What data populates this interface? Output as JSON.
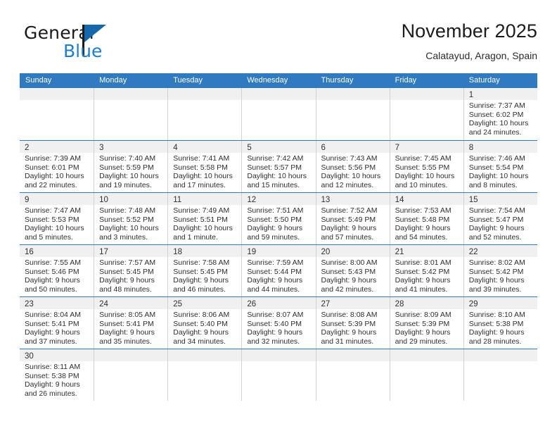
{
  "brand": {
    "name_part1": "General",
    "name_part2": "Blue",
    "flag_icon": "blue-triangle-flag",
    "colors": {
      "dark": "#1a1a1a",
      "blue": "#1a7fd4",
      "flag": "#1667ad"
    }
  },
  "header": {
    "title": "November 2025",
    "subtitle": "Calatayud, Aragon, Spain"
  },
  "theme": {
    "header_bar": "#2f7ac0",
    "row_divider": "#2f7ac0",
    "cell_divider": "#d2d2d2",
    "daynum_band": "#f0f0f0"
  },
  "calendar": {
    "weekday_headers": [
      "Sunday",
      "Monday",
      "Tuesday",
      "Wednesday",
      "Thursday",
      "Friday",
      "Saturday"
    ],
    "weeks": [
      [
        {
          "day": "",
          "lines": []
        },
        {
          "day": "",
          "lines": []
        },
        {
          "day": "",
          "lines": []
        },
        {
          "day": "",
          "lines": []
        },
        {
          "day": "",
          "lines": []
        },
        {
          "day": "",
          "lines": []
        },
        {
          "day": "1",
          "lines": [
            "Sunrise: 7:37 AM",
            "Sunset: 6:02 PM",
            "Daylight: 10 hours",
            "and 24 minutes."
          ]
        }
      ],
      [
        {
          "day": "2",
          "lines": [
            "Sunrise: 7:39 AM",
            "Sunset: 6:01 PM",
            "Daylight: 10 hours",
            "and 22 minutes."
          ]
        },
        {
          "day": "3",
          "lines": [
            "Sunrise: 7:40 AM",
            "Sunset: 5:59 PM",
            "Daylight: 10 hours",
            "and 19 minutes."
          ]
        },
        {
          "day": "4",
          "lines": [
            "Sunrise: 7:41 AM",
            "Sunset: 5:58 PM",
            "Daylight: 10 hours",
            "and 17 minutes."
          ]
        },
        {
          "day": "5",
          "lines": [
            "Sunrise: 7:42 AM",
            "Sunset: 5:57 PM",
            "Daylight: 10 hours",
            "and 15 minutes."
          ]
        },
        {
          "day": "6",
          "lines": [
            "Sunrise: 7:43 AM",
            "Sunset: 5:56 PM",
            "Daylight: 10 hours",
            "and 12 minutes."
          ]
        },
        {
          "day": "7",
          "lines": [
            "Sunrise: 7:45 AM",
            "Sunset: 5:55 PM",
            "Daylight: 10 hours",
            "and 10 minutes."
          ]
        },
        {
          "day": "8",
          "lines": [
            "Sunrise: 7:46 AM",
            "Sunset: 5:54 PM",
            "Daylight: 10 hours",
            "and 8 minutes."
          ]
        }
      ],
      [
        {
          "day": "9",
          "lines": [
            "Sunrise: 7:47 AM",
            "Sunset: 5:53 PM",
            "Daylight: 10 hours",
            "and 5 minutes."
          ]
        },
        {
          "day": "10",
          "lines": [
            "Sunrise: 7:48 AM",
            "Sunset: 5:52 PM",
            "Daylight: 10 hours",
            "and 3 minutes."
          ]
        },
        {
          "day": "11",
          "lines": [
            "Sunrise: 7:49 AM",
            "Sunset: 5:51 PM",
            "Daylight: 10 hours",
            "and 1 minute."
          ]
        },
        {
          "day": "12",
          "lines": [
            "Sunrise: 7:51 AM",
            "Sunset: 5:50 PM",
            "Daylight: 9 hours",
            "and 59 minutes."
          ]
        },
        {
          "day": "13",
          "lines": [
            "Sunrise: 7:52 AM",
            "Sunset: 5:49 PM",
            "Daylight: 9 hours",
            "and 57 minutes."
          ]
        },
        {
          "day": "14",
          "lines": [
            "Sunrise: 7:53 AM",
            "Sunset: 5:48 PM",
            "Daylight: 9 hours",
            "and 54 minutes."
          ]
        },
        {
          "day": "15",
          "lines": [
            "Sunrise: 7:54 AM",
            "Sunset: 5:47 PM",
            "Daylight: 9 hours",
            "and 52 minutes."
          ]
        }
      ],
      [
        {
          "day": "16",
          "lines": [
            "Sunrise: 7:55 AM",
            "Sunset: 5:46 PM",
            "Daylight: 9 hours",
            "and 50 minutes."
          ]
        },
        {
          "day": "17",
          "lines": [
            "Sunrise: 7:57 AM",
            "Sunset: 5:45 PM",
            "Daylight: 9 hours",
            "and 48 minutes."
          ]
        },
        {
          "day": "18",
          "lines": [
            "Sunrise: 7:58 AM",
            "Sunset: 5:45 PM",
            "Daylight: 9 hours",
            "and 46 minutes."
          ]
        },
        {
          "day": "19",
          "lines": [
            "Sunrise: 7:59 AM",
            "Sunset: 5:44 PM",
            "Daylight: 9 hours",
            "and 44 minutes."
          ]
        },
        {
          "day": "20",
          "lines": [
            "Sunrise: 8:00 AM",
            "Sunset: 5:43 PM",
            "Daylight: 9 hours",
            "and 42 minutes."
          ]
        },
        {
          "day": "21",
          "lines": [
            "Sunrise: 8:01 AM",
            "Sunset: 5:42 PM",
            "Daylight: 9 hours",
            "and 41 minutes."
          ]
        },
        {
          "day": "22",
          "lines": [
            "Sunrise: 8:02 AM",
            "Sunset: 5:42 PM",
            "Daylight: 9 hours",
            "and 39 minutes."
          ]
        }
      ],
      [
        {
          "day": "23",
          "lines": [
            "Sunrise: 8:04 AM",
            "Sunset: 5:41 PM",
            "Daylight: 9 hours",
            "and 37 minutes."
          ]
        },
        {
          "day": "24",
          "lines": [
            "Sunrise: 8:05 AM",
            "Sunset: 5:41 PM",
            "Daylight: 9 hours",
            "and 35 minutes."
          ]
        },
        {
          "day": "25",
          "lines": [
            "Sunrise: 8:06 AM",
            "Sunset: 5:40 PM",
            "Daylight: 9 hours",
            "and 34 minutes."
          ]
        },
        {
          "day": "26",
          "lines": [
            "Sunrise: 8:07 AM",
            "Sunset: 5:40 PM",
            "Daylight: 9 hours",
            "and 32 minutes."
          ]
        },
        {
          "day": "27",
          "lines": [
            "Sunrise: 8:08 AM",
            "Sunset: 5:39 PM",
            "Daylight: 9 hours",
            "and 31 minutes."
          ]
        },
        {
          "day": "28",
          "lines": [
            "Sunrise: 8:09 AM",
            "Sunset: 5:39 PM",
            "Daylight: 9 hours",
            "and 29 minutes."
          ]
        },
        {
          "day": "29",
          "lines": [
            "Sunrise: 8:10 AM",
            "Sunset: 5:38 PM",
            "Daylight: 9 hours",
            "and 28 minutes."
          ]
        }
      ],
      [
        {
          "day": "30",
          "lines": [
            "Sunrise: 8:11 AM",
            "Sunset: 5:38 PM",
            "Daylight: 9 hours",
            "and 26 minutes."
          ]
        },
        {
          "day": "",
          "lines": []
        },
        {
          "day": "",
          "lines": []
        },
        {
          "day": "",
          "lines": []
        },
        {
          "day": "",
          "lines": []
        },
        {
          "day": "",
          "lines": []
        },
        {
          "day": "",
          "lines": []
        }
      ]
    ]
  }
}
